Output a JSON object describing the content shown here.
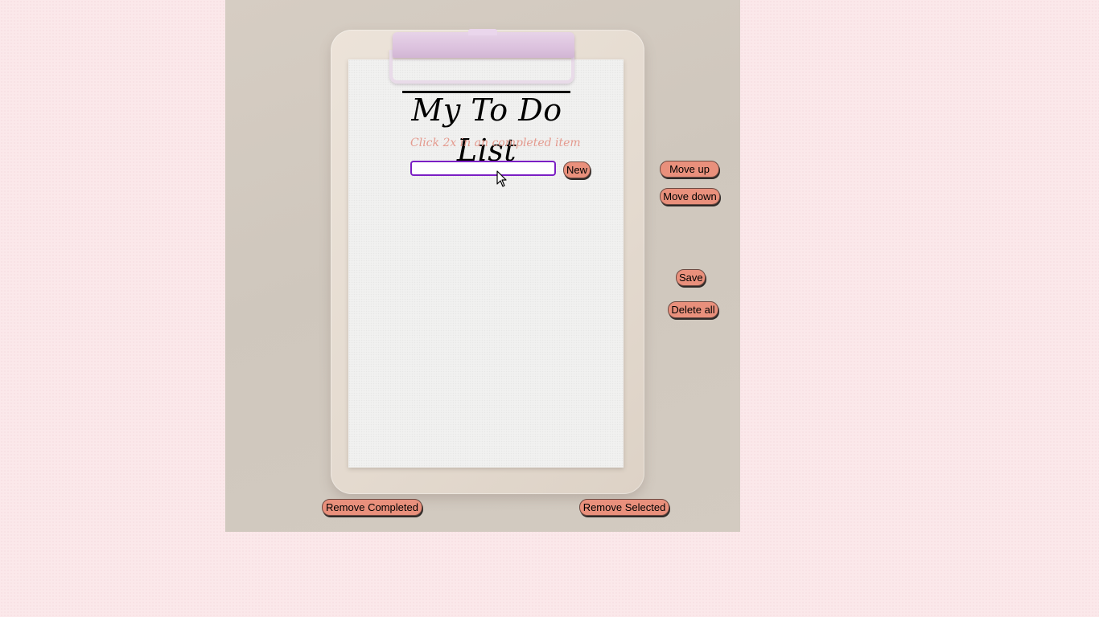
{
  "app": {
    "title": "My To Do List",
    "subtitle": "Click 2x in an completed item"
  },
  "new_item": {
    "value": "",
    "placeholder": "",
    "button_label": "New"
  },
  "side_controls": {
    "move_up_label": "Move up",
    "move_down_label": "Move down",
    "save_label": "Save",
    "delete_all_label": "Delete all"
  },
  "bottom_controls": {
    "remove_completed_label": "Remove Completed",
    "remove_selected_label": "Remove Selected"
  },
  "todo_items": [],
  "colors": {
    "button_bg": "#e9907c",
    "subtitle": "#e49a8e",
    "input_border": "#7b1fc4",
    "clip": "#dcc2de",
    "page_bg": "#fbe8ea"
  },
  "icons": {
    "cursor": "mouse-pointer-icon"
  }
}
